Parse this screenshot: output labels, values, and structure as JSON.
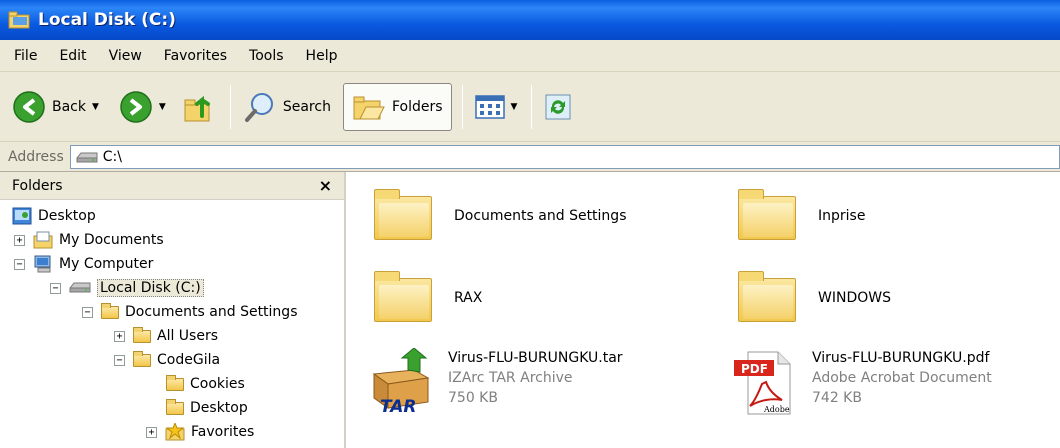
{
  "window": {
    "title": "Local Disk (C:)"
  },
  "menu": [
    "File",
    "Edit",
    "View",
    "Favorites",
    "Tools",
    "Help"
  ],
  "toolbar": {
    "back": "Back",
    "search": "Search",
    "folders": "Folders"
  },
  "address": {
    "label": "Address",
    "value": "C:\\"
  },
  "folders_pane": {
    "title": "Folders",
    "close": "×",
    "tree": [
      {
        "label": "Desktop",
        "level": 0,
        "expander": "",
        "icon": "desktop-icon"
      },
      {
        "label": "My Documents",
        "level": 1,
        "expander": "+",
        "icon": "my-documents-icon"
      },
      {
        "label": "My Computer",
        "level": 1,
        "expander": "−",
        "icon": "my-computer-icon"
      },
      {
        "label": "Local Disk (C:)",
        "level": 2,
        "expander": "−",
        "icon": "drive-icon",
        "selected": true
      },
      {
        "label": "Documents and Settings",
        "level": 3,
        "expander": "−",
        "icon": "folder-icon"
      },
      {
        "label": "All Users",
        "level": 4,
        "expander": "+",
        "icon": "folder-icon"
      },
      {
        "label": "CodeGila",
        "level": 4,
        "expander": "−",
        "icon": "folder-icon"
      },
      {
        "label": "Cookies",
        "level": 5,
        "expander": "",
        "icon": "folder-icon"
      },
      {
        "label": "Desktop",
        "level": 5,
        "expander": "",
        "icon": "folder-icon"
      },
      {
        "label": "Favorites",
        "level": 5,
        "expander": "+",
        "icon": "star-folder-icon"
      }
    ]
  },
  "items": [
    {
      "name": "Documents and Settings",
      "type": "folder"
    },
    {
      "name": "Inprise",
      "type": "folder"
    },
    {
      "name": "RAX",
      "type": "folder"
    },
    {
      "name": "WINDOWS",
      "type": "folder"
    },
    {
      "name": "Virus-FLU-BURUNGKU.tar",
      "desc": "IZArc TAR Archive",
      "size": "750 KB",
      "type": "tar",
      "badge": "TAR"
    },
    {
      "name": "Virus-FLU-BURUNGKU.pdf",
      "desc": "Adobe Acrobat Document",
      "size": "742 KB",
      "type": "pdf",
      "badge": "PDF",
      "badge2": "Adobe"
    }
  ],
  "colors": {
    "titlebar": "#0a5ae0",
    "chrome": "#ece9d8",
    "folder": "#f2c84b"
  }
}
